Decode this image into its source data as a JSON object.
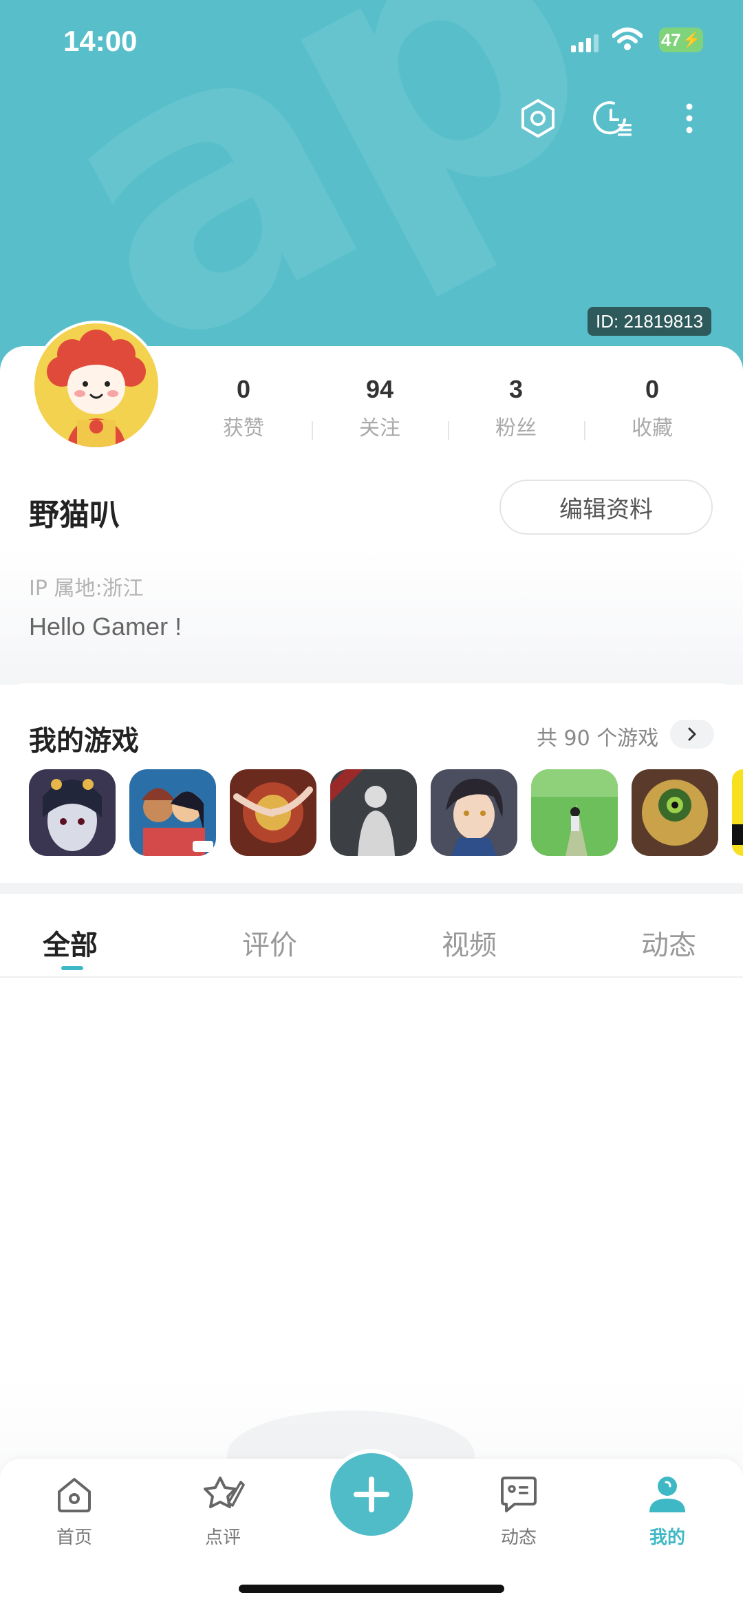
{
  "status_bar": {
    "time": "14:00",
    "battery": "47"
  },
  "profile": {
    "id_label": "ID: 21819813",
    "username": "野猫叭",
    "edit_button": "编辑资料",
    "ip_location": "IP 属地:浙江",
    "bio": "Hello Gamer !",
    "stats": [
      {
        "value": "0",
        "label": "获赞"
      },
      {
        "value": "94",
        "label": "关注"
      },
      {
        "value": "3",
        "label": "粉丝"
      },
      {
        "value": "0",
        "label": "收藏"
      }
    ]
  },
  "my_games": {
    "title": "我的游戏",
    "count_label": "共 90 个游戏"
  },
  "tabs": [
    {
      "label": "全部",
      "active": true
    },
    {
      "label": "评价",
      "active": false
    },
    {
      "label": "视频",
      "active": false
    },
    {
      "label": "动态",
      "active": false
    }
  ],
  "bottom_nav": [
    {
      "label": "首页",
      "icon": "home-icon",
      "active": false
    },
    {
      "label": "点评",
      "icon": "review-star-icon",
      "active": false
    },
    {
      "label": "动态",
      "icon": "feed-message-icon",
      "active": false
    },
    {
      "label": "我的",
      "icon": "user-icon",
      "active": true
    }
  ],
  "colors": {
    "header_bg": "#58bfca",
    "accent": "#3fb8c6",
    "avatar_bg": "#f3d24f"
  }
}
